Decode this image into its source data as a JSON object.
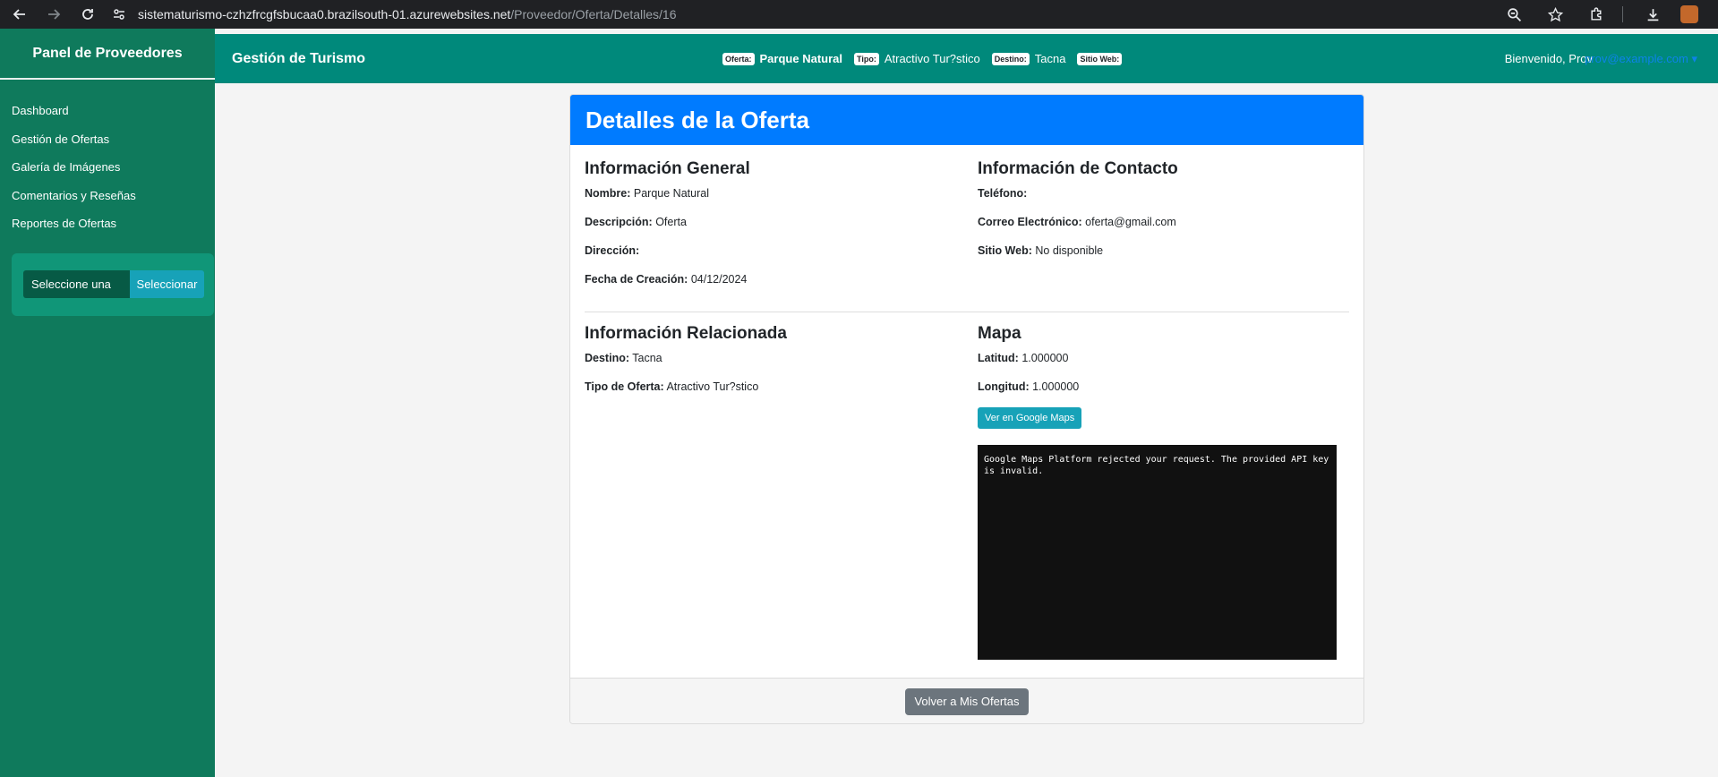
{
  "browser": {
    "url_host": "sistematurismo-czhzfrcgfsbucaa0.brazilsouth-01.azurewebsites.net",
    "url_path": "/Proveedor/Oferta/Detalles/16"
  },
  "sidebar": {
    "title": "Panel de Proveedores",
    "items": [
      {
        "label": "Dashboard"
      },
      {
        "label": "Gestión de Ofertas"
      },
      {
        "label": "Galería de Imágenes"
      },
      {
        "label": "Comentarios y Reseñas"
      },
      {
        "label": "Reportes de Ofertas"
      }
    ],
    "select_value": "Seleccione una",
    "select_button": "Seleccionar"
  },
  "topbar": {
    "title": "Gestión de Turismo",
    "oferta_badge": "Oferta:",
    "oferta_value": "Parque Natural",
    "tipo_badge": "Tipo:",
    "tipo_value": "Atractivo Tur?stico",
    "destino_badge": "Destino:",
    "destino_value": "Tacna",
    "sitio_badge": "Sitio Web:",
    "welcome": "Bienvenido, Prov",
    "user_link": "prov@example.com ▾"
  },
  "card": {
    "header": "Detalles de la Oferta",
    "general": {
      "title": "Información General",
      "nombre_label": "Nombre:",
      "nombre_value": "Parque Natural",
      "descripcion_label": "Descripción:",
      "descripcion_value": "Oferta",
      "direccion_label": "Dirección:",
      "direccion_value": "",
      "fecha_label": "Fecha de Creación:",
      "fecha_value": "04/12/2024"
    },
    "contacto": {
      "title": "Información de Contacto",
      "telefono_label": "Teléfono:",
      "telefono_value": "",
      "correo_label": "Correo Electrónico:",
      "correo_value": "oferta@gmail.com",
      "sitio_label": "Sitio Web:",
      "sitio_value": "No disponible"
    },
    "relacionada": {
      "title": "Información Relacionada",
      "destino_label": "Destino:",
      "destino_value": "Tacna",
      "tipo_label": "Tipo de Oferta:",
      "tipo_value": "Atractivo Tur?stico"
    },
    "mapa": {
      "title": "Mapa",
      "latitud_label": "Latitud:",
      "latitud_value": "1.000000",
      "longitud_label": "Longitud:",
      "longitud_value": "1.000000",
      "maps_button": "Ver en Google Maps",
      "error_text": "Google Maps Platform rejected your request. The provided API key is invalid."
    },
    "back_button": "Volver a Mis Ofertas"
  }
}
